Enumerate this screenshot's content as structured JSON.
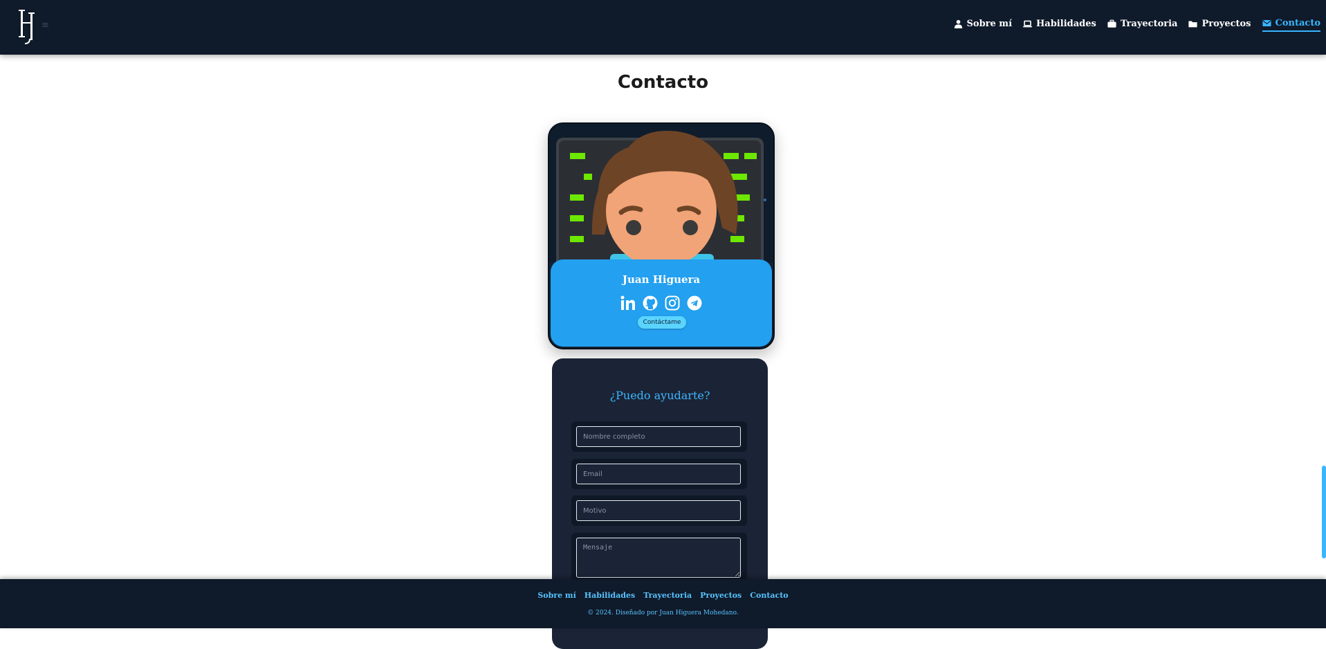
{
  "header": {
    "logo_text": "JH",
    "nav": [
      {
        "label": "Sobre mí",
        "icon": "user-icon"
      },
      {
        "label": "Habilidades",
        "icon": "laptop-icon"
      },
      {
        "label": "Trayectoria",
        "icon": "briefcase-icon"
      },
      {
        "label": "Proyectos",
        "icon": "folder-icon"
      },
      {
        "label": "Contacto",
        "icon": "envelope-icon",
        "active": true
      }
    ]
  },
  "section": {
    "title": "Contacto"
  },
  "profile": {
    "name": "Juan Higuera",
    "socials": [
      "linkedin-icon",
      "github-icon",
      "instagram-icon",
      "telegram-icon"
    ],
    "contact_button": "Contáctame"
  },
  "form": {
    "title": "¿Puedo ayudarte?",
    "fields": {
      "name_placeholder": "Nombre completo",
      "email_placeholder": "Email",
      "reason_placeholder": "Motivo",
      "message_placeholder": "Mensaje"
    }
  },
  "footer": {
    "links": [
      "Sobre mí",
      "Habilidades",
      "Trayectoria",
      "Proyectos",
      "Contacto"
    ],
    "copyright": "© 2024. Diseñado por Juan Higuera Mohedano."
  },
  "colors": {
    "navbar": "#0f1a2a",
    "accent": "#38b6ff",
    "card_blue": "#23a0ef",
    "form_bg": "#1a2436"
  }
}
